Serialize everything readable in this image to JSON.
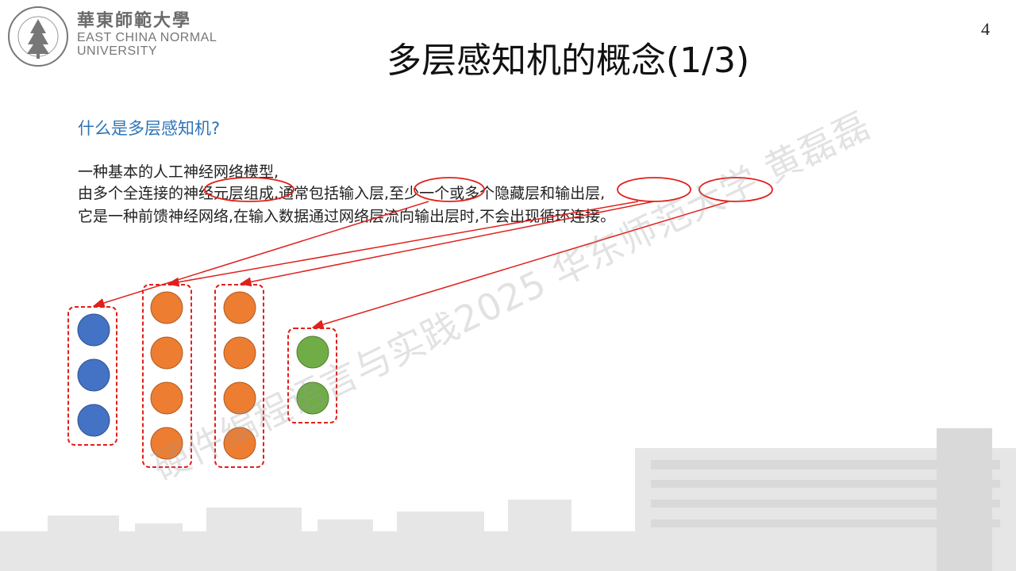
{
  "slide": {
    "page_number": "4",
    "title": "多层感知机的概念(1/3)"
  },
  "logo": {
    "chinese_name": "華東師範大學",
    "english_line1": "EAST CHINA NORMAL",
    "english_line2": "UNIVERSITY",
    "seal_text": "EAST CHINA NORMAL UNIVERSITY 華東師範大學"
  },
  "content": {
    "question": "什么是多层感知机?",
    "lines": [
      "一种基本的人工神经网络模型,",
      "由多个全连接的神经元层组成,通常包括输入层,至少一个或多个隐藏层和输出层,",
      "它是一种前馈神经网络,在输入数据通过网络层流向输出层时,不会出现循环连接。"
    ]
  },
  "network": {
    "layers": [
      {
        "role": "input",
        "neurons": 3,
        "color": "#4472c4"
      },
      {
        "role": "hidden",
        "neurons": 4,
        "color": "#ed7d31"
      },
      {
        "role": "hidden",
        "neurons": 4,
        "color": "#ed7d31"
      },
      {
        "role": "output",
        "neurons": 2,
        "color": "#70ad47"
      }
    ],
    "annotation_color": "#e0201b"
  },
  "watermark": "硬件编程语言与实践2025 华东师范大学 黄磊磊"
}
